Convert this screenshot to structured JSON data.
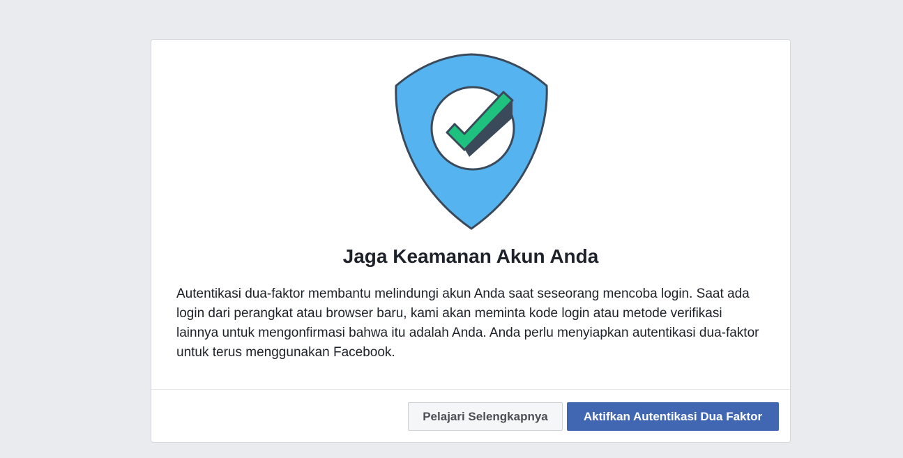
{
  "dialog": {
    "title": "Jaga Keamanan Akun Anda",
    "description": "Autentikasi dua-faktor membantu melindungi akun Anda saat seseorang mencoba login. Saat ada login dari perangkat atau browser baru, kami akan meminta kode login atau metode verifikasi lainnya untuk mengonfirmasi bahwa itu adalah Anda. Anda perlu menyiapkan autentikasi dua-faktor untuk terus menggunakan Facebook.",
    "illustration": "shield-check-icon"
  },
  "actions": {
    "learn_more_label": "Pelajari Selengkapnya",
    "enable_label": "Aktifkan Autentikasi Dua Faktor"
  },
  "colors": {
    "page_background": "#e9ebee",
    "primary_button": "#4267b2",
    "shield_fill": "#55b4f0",
    "check_green": "#1ec17e",
    "outline": "#3b4a5a"
  }
}
